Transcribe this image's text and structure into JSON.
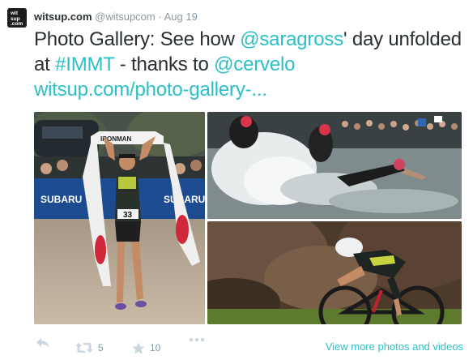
{
  "account": {
    "avatar_line1": "wit",
    "avatar_line2": "sup",
    "avatar_line3": ".com",
    "display_name": "witsup.com",
    "handle": "@witsupcom",
    "separator": "·",
    "time": "Aug 19"
  },
  "tweet": {
    "part1": "Photo Gallery: See how ",
    "mention1": "@saragross",
    "part2": "' day unfolded at ",
    "hashtag": "#IMMT",
    "part3": " - thanks to ",
    "mention2": "@cervelo",
    "url": "witsup.com/photo-gallery-..."
  },
  "media": {
    "left_alt": "Runner crossing finish line",
    "top_right_alt": "Swim start splash",
    "bottom_right_alt": "Cyclist on time trial bike",
    "finish_banner_text": "IRONMAN",
    "bib_number": "33",
    "sponsor_text": "SUBARU"
  },
  "actions": {
    "reply_icon": "reply-icon",
    "retweet_icon": "retweet-icon",
    "retweet_count": "5",
    "favorite_icon": "star-icon",
    "favorite_count": "10",
    "more_icon": "more-icon",
    "view_more_label": "View more photos and videos"
  },
  "colors": {
    "link": "#2bc0c9",
    "text": "#292f33",
    "muted": "#8899a6",
    "icon": "#ccd6dd"
  }
}
